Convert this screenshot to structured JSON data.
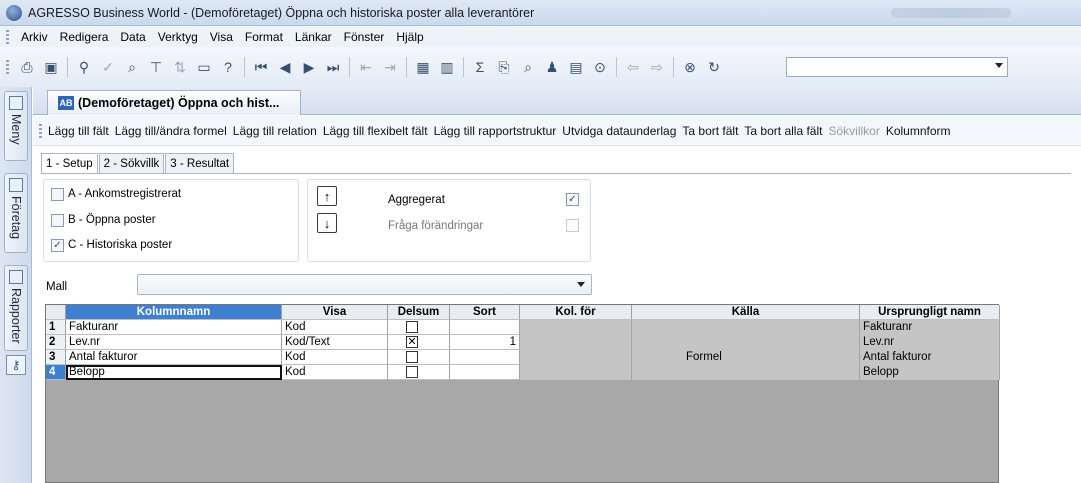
{
  "window": {
    "title": "AGRESSO Business World - (Demoföretaget) Öppna och historiska poster alla leverantörer"
  },
  "menu": [
    {
      "label": "Arkiv"
    },
    {
      "label": "Redigera"
    },
    {
      "label": "Data"
    },
    {
      "label": "Verktyg"
    },
    {
      "label": "Visa"
    },
    {
      "label": "Format"
    },
    {
      "label": "Länkar"
    },
    {
      "label": "Fönster"
    },
    {
      "label": "Hjälp"
    }
  ],
  "toolbar": {
    "icons": [
      "print-icon",
      "save-icon",
      "find-icon",
      "check-icon",
      "zoom-icon",
      "filter-icon",
      "sort-icon",
      "window-icon",
      "help-icon",
      "first-icon",
      "prev-icon",
      "next-icon",
      "last-icon",
      "indent-icon",
      "outdent-icon",
      "table-icon",
      "chart-icon",
      "sum-icon",
      "copy-icon",
      "search-icon",
      "users-icon",
      "screen-icon",
      "binoculars-icon",
      "back-icon",
      "forward-icon",
      "stop-icon",
      "refresh-icon"
    ],
    "glyphs": [
      "⎙",
      "▣",
      "⚲",
      "✓",
      "⌕",
      "⊤",
      "⇅",
      "▭",
      "?",
      "⏮",
      "◀",
      "▶",
      "⏭",
      "⇤",
      "⇥",
      "▦",
      "▥",
      "Σ",
      "⎘",
      "⌕",
      "♟",
      "▤",
      "⊙",
      "⇦",
      "⇨",
      "⊗",
      "↻"
    ]
  },
  "sidebar": {
    "tabs": [
      {
        "label": "Meny"
      },
      {
        "label": "Företag"
      },
      {
        "label": "Rapporter"
      }
    ]
  },
  "document": {
    "tab_label": "(Demoföretaget) Öppna och hist...",
    "tab_icon_text": "AB"
  },
  "actions": [
    {
      "label": "Lägg till fält",
      "enabled": true
    },
    {
      "label": "Lägg till/ändra formel",
      "enabled": true
    },
    {
      "label": "Lägg till relation",
      "enabled": true
    },
    {
      "label": "Lägg till flexibelt fält",
      "enabled": true
    },
    {
      "label": "Lägg till rapportstruktur",
      "enabled": true
    },
    {
      "label": "Utvidga dataunderlag",
      "enabled": true
    },
    {
      "label": "Ta bort fält",
      "enabled": true
    },
    {
      "label": "Ta bort alla fält",
      "enabled": true
    },
    {
      "label": "Sökvillkor",
      "enabled": false
    },
    {
      "label": "Kolumnform",
      "enabled": true
    }
  ],
  "inner_tabs": [
    {
      "label": "1 - Setup",
      "active": true
    },
    {
      "label": "2 - Sökvillk",
      "active": false
    },
    {
      "label": "3 - Resultat",
      "active": false
    }
  ],
  "setup": {
    "options": [
      {
        "label": "A - Ankomstregistrerat",
        "checked": false
      },
      {
        "label": "B - Öppna poster",
        "checked": false
      },
      {
        "label": "C - Historiska poster",
        "checked": true
      }
    ],
    "aggregerat": {
      "label": "Aggregerat",
      "checked": true
    },
    "fraga": {
      "label": "Fråga förändringar",
      "checked": false
    },
    "up_arrow": "↑",
    "down_arrow": "↓"
  },
  "mall": {
    "label": "Mall",
    "value": ""
  },
  "grid": {
    "columns": [
      "Kolumnnamn",
      "Visa",
      "Delsum",
      "Sort",
      "Kol. för",
      "Källa",
      "Ursprungligt namn"
    ],
    "rows": [
      {
        "num": "1",
        "name": "Fakturanr",
        "visa": "Kod",
        "delsum": false,
        "sort": "",
        "kol": "",
        "kalla": "",
        "orig": "Fakturanr"
      },
      {
        "num": "2",
        "name": "Lev.nr",
        "visa": "Kod/Text",
        "delsum": true,
        "sort": "1",
        "kol": "",
        "kalla": "",
        "orig": "Lev.nr"
      },
      {
        "num": "3",
        "name": "Antal fakturor",
        "visa": "Kod",
        "delsum": false,
        "sort": "",
        "kol": "",
        "kalla": "Formel",
        "orig": "Antal fakturor"
      },
      {
        "num": "4",
        "name": "Belopp",
        "visa": "Kod",
        "delsum": false,
        "sort": "",
        "kol": "",
        "kalla": "",
        "orig": "Belopp"
      }
    ]
  }
}
